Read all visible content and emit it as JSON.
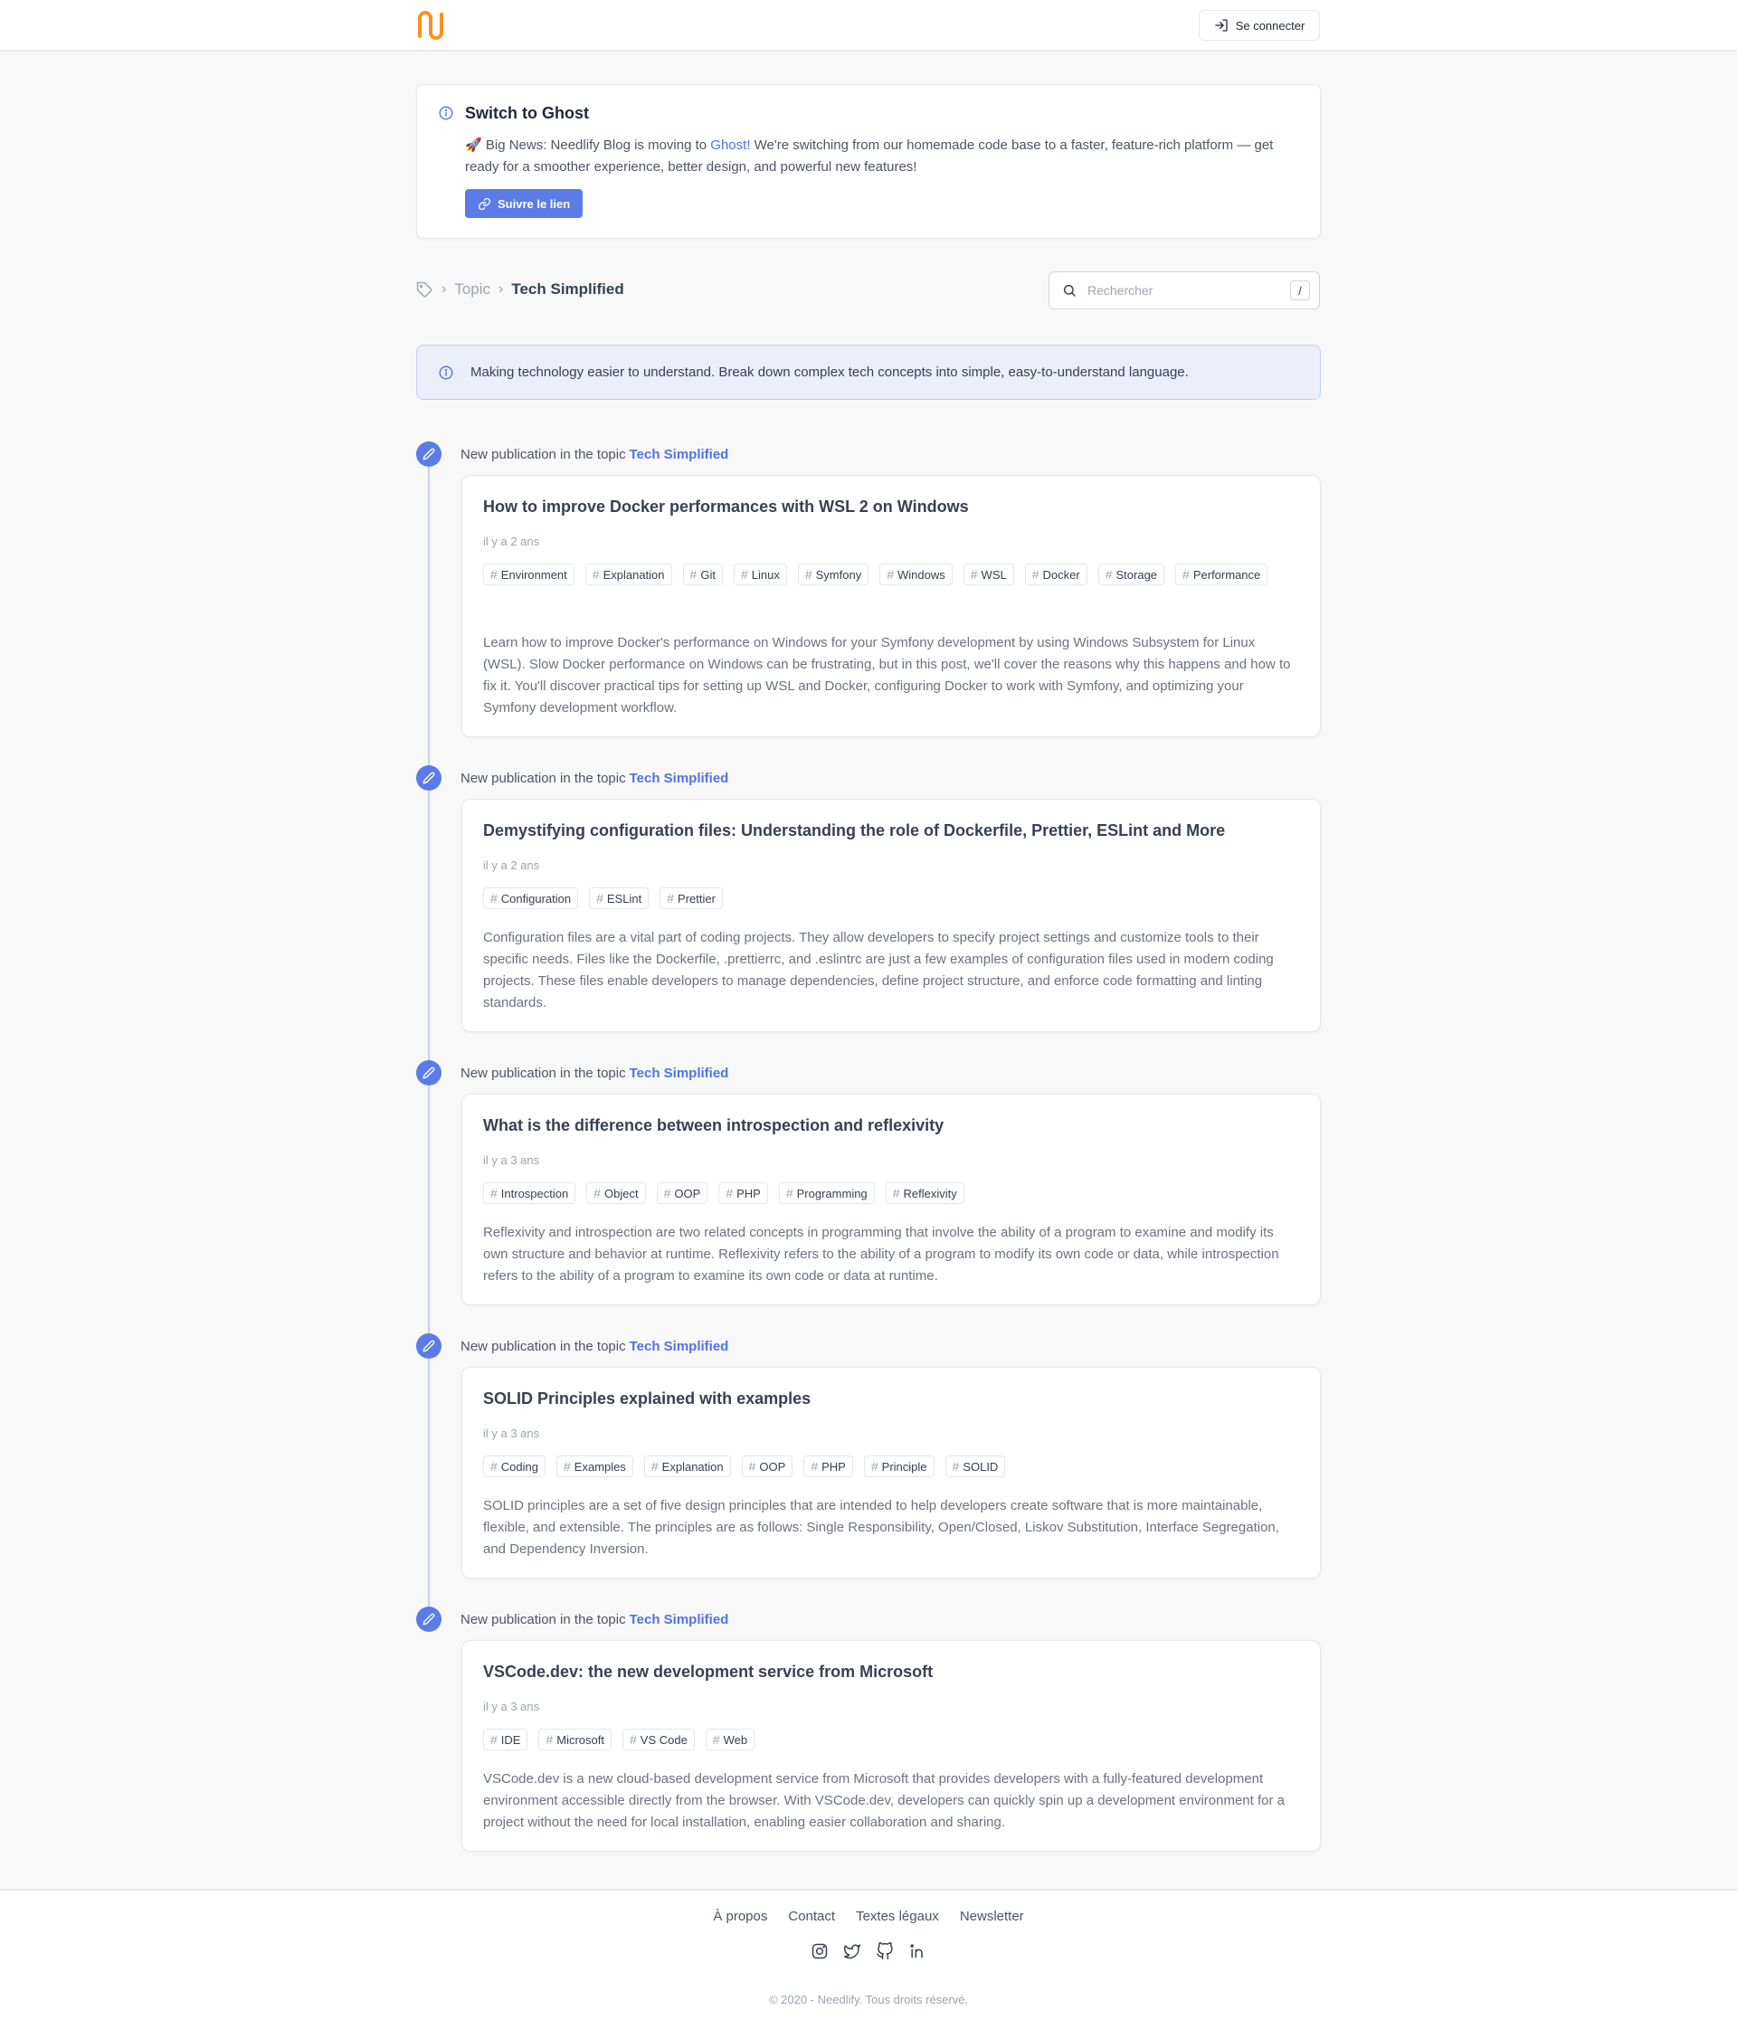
{
  "header": {
    "logo_alt": "Needlify",
    "login_label": "Se connecter"
  },
  "announcement": {
    "title": "Switch to Ghost",
    "emoji": "🚀",
    "text_before": " Big News: Needlify Blog is moving to ",
    "link_text": "Ghost!",
    "text_after": " We're switching from our homemade code base to a faster, feature-rich platform — get ready for a smoother experience, better design, and powerful new features!",
    "button_label": "Suivre le lien"
  },
  "breadcrumb": {
    "parent": "Topic",
    "current": "Tech Simplified"
  },
  "search": {
    "placeholder": "Rechercher",
    "shortcut": "/"
  },
  "topic_description": "Making technology easier to understand. Break down complex tech concepts into simple, easy-to-understand language.",
  "timeline": {
    "event_prefix": "New publication in the topic",
    "topic_name": "Tech Simplified"
  },
  "posts": [
    {
      "title": "How to improve Docker performances with WSL 2 on Windows",
      "date": "il y a 2 ans",
      "tags": [
        "Environment",
        "Explanation",
        "Git",
        "Linux",
        "Symfony",
        "Windows",
        "WSL",
        "Docker",
        "Storage",
        "Performance"
      ],
      "excerpt": "Learn how to improve Docker's performance on Windows for your Symfony development by using Windows Subsystem for Linux (WSL). Slow Docker performance on Windows can be frustrating, but in this post, we'll cover the reasons why this happens and how to fix it. You'll discover practical tips for setting up WSL and Docker, configuring Docker to work with Symfony, and optimizing your Symfony development workflow."
    },
    {
      "title": "Demystifying configuration files: Understanding the role of Dockerfile, Prettier, ESLint and More",
      "date": "il y a 2 ans",
      "tags": [
        "Configuration",
        "ESLint",
        "Prettier"
      ],
      "excerpt": "Configuration files are a vital part of coding projects. They allow developers to specify project settings and customize tools to their specific needs. Files like the Dockerfile, .prettierrc, and .eslintrc are just a few examples of configuration files used in modern coding projects. These files enable developers to manage dependencies, define project structure, and enforce code formatting and linting standards."
    },
    {
      "title": "What is the difference between introspection and reflexivity",
      "date": "il y a 3 ans",
      "tags": [
        "Introspection",
        "Object",
        "OOP",
        "PHP",
        "Programming",
        "Reflexivity"
      ],
      "excerpt": "Reflexivity and introspection are two related concepts in programming that involve the ability of a program to examine and modify its own structure and behavior at runtime. Reflexivity refers to the ability of a program to modify its own code or data, while introspection refers to the ability of a program to examine its own code or data at runtime."
    },
    {
      "title": "SOLID Principles explained with examples",
      "date": "il y a 3 ans",
      "tags": [
        "Coding",
        "Examples",
        "Explanation",
        "OOP",
        "PHP",
        "Principle",
        "SOLID"
      ],
      "excerpt": "SOLID principles are a set of five design principles that are intended to help developers create software that is more maintainable, flexible, and extensible. The principles are as follows: Single Responsibility, Open/Closed, Liskov Substitution, Interface Segregation, and Dependency Inversion."
    },
    {
      "title": "VSCode.dev: the new development service from Microsoft",
      "date": "il y a 3 ans",
      "tags": [
        "IDE",
        "Microsoft",
        "VS Code",
        "Web"
      ],
      "excerpt": "VSCode.dev is a new cloud-based development service from Microsoft that provides developers with a fully-featured development environment accessible directly from the browser. With VSCode.dev, developers can quickly spin up a development environment for a project without the need for local installation, enabling easier collaboration and sharing."
    }
  ],
  "footer": {
    "links": [
      "À propos",
      "Contact",
      "Textes légaux",
      "Newsletter"
    ],
    "socials": [
      "instagram-icon",
      "twitter-icon",
      "github-icon",
      "linkedin-icon"
    ],
    "copyright": "© 2020 - Needlify. Tous droits réservé."
  },
  "colors": {
    "accent": "#5b7ce8",
    "link": "#4f73e5",
    "logo": "#f7931e",
    "info_bg": "#eceef9"
  }
}
